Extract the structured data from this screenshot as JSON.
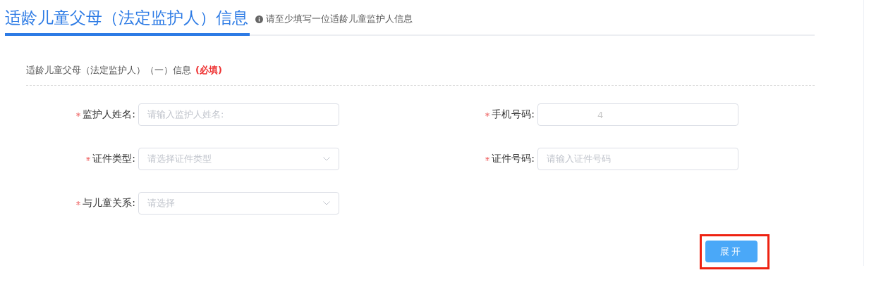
{
  "header": {
    "title": "适龄儿童父母（法定监护人）信息",
    "hint": "请至少填写一位适龄儿童监护人信息"
  },
  "section": {
    "title": "适龄儿童父母（法定监护人）（一）信息",
    "required_note": "(必填)"
  },
  "fields": [
    {
      "kind": "text",
      "label": "监护人姓名:",
      "required": true,
      "placeholder": "请输入监护人姓名:"
    },
    {
      "kind": "text",
      "label": "手机号码:",
      "required": true,
      "value": "4"
    },
    {
      "kind": "select",
      "label": "证件类型:",
      "required": true,
      "placeholder": "请选择证件类型"
    },
    {
      "kind": "text",
      "label": "证件号码:",
      "required": true,
      "placeholder": "请输入证件号码"
    },
    {
      "kind": "select",
      "label": "与儿童关系:",
      "required": true,
      "placeholder": "请选择"
    }
  ],
  "expand_button": {
    "label": "展开",
    "highlighted": true
  }
}
